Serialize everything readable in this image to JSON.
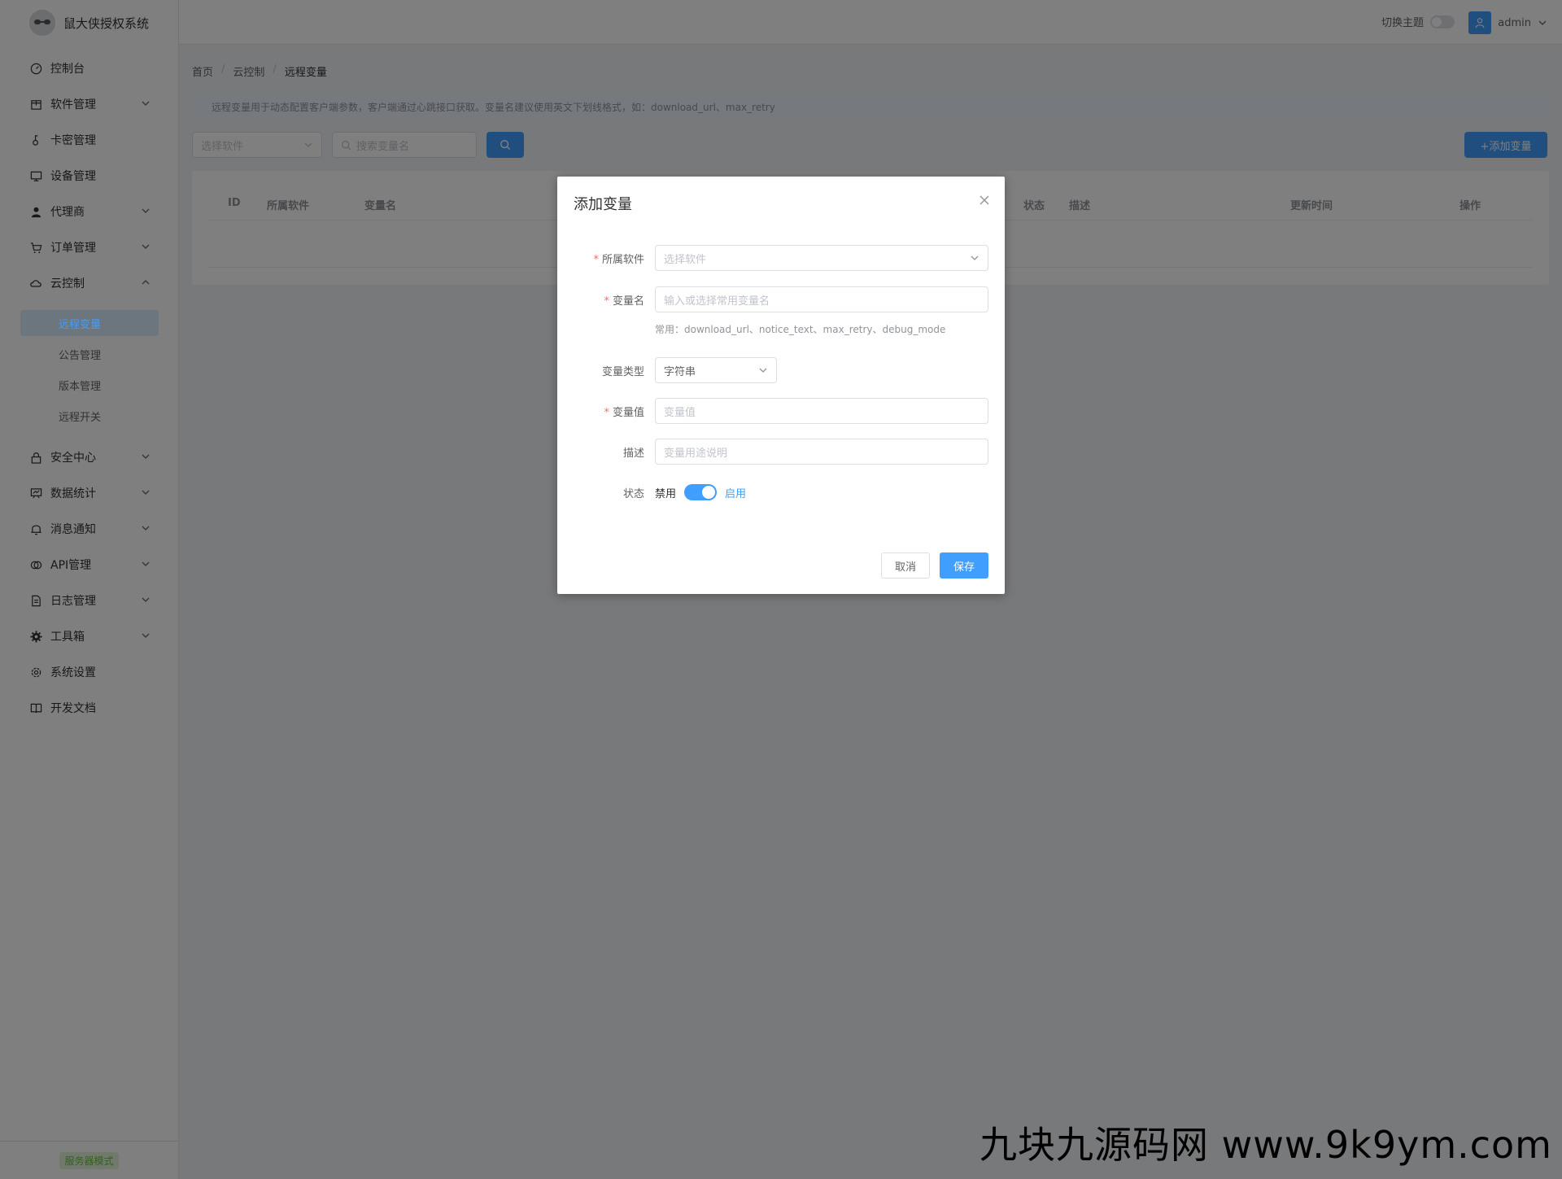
{
  "app": {
    "title": "鼠大侠授权系统"
  },
  "sidebar": {
    "items": [
      {
        "label": "控制台",
        "icon": "dashboard-icon"
      },
      {
        "label": "软件管理",
        "icon": "package-icon",
        "arrow": "down"
      },
      {
        "label": "卡密管理",
        "icon": "key-icon"
      },
      {
        "label": "设备管理",
        "icon": "monitor-icon"
      },
      {
        "label": "代理商",
        "icon": "user-icon",
        "arrow": "down"
      },
      {
        "label": "订单管理",
        "icon": "cart-icon",
        "arrow": "down"
      },
      {
        "label": "云控制",
        "icon": "cloud-icon",
        "arrow": "up"
      }
    ],
    "cloud_sub": [
      "远程变量",
      "公告管理",
      "版本管理",
      "远程开关"
    ],
    "items_after": [
      {
        "label": "安全中心",
        "icon": "lock-icon",
        "arrow": "down"
      },
      {
        "label": "数据统计",
        "icon": "chart-icon",
        "arrow": "down"
      },
      {
        "label": "消息通知",
        "icon": "bell-icon",
        "arrow": "down"
      },
      {
        "label": "API管理",
        "icon": "api-icon",
        "arrow": "down"
      },
      {
        "label": "日志管理",
        "icon": "document-icon",
        "arrow": "down"
      },
      {
        "label": "工具箱",
        "icon": "gear-icon",
        "arrow": "down"
      },
      {
        "label": "系统设置",
        "icon": "settings-icon"
      },
      {
        "label": "开发文档",
        "icon": "book-icon"
      }
    ],
    "footer_tag": "服务器模式"
  },
  "header": {
    "theme_label": "切换主题",
    "user_name": "admin"
  },
  "breadcrumb": {
    "home": "首页",
    "parent": "云控制",
    "current": "远程变量"
  },
  "tip": "远程变量用于动态配置客户端参数，客户端通过心跳接口获取。变量名建议使用英文下划线格式，如：download_url、max_retry",
  "filters": {
    "software_placeholder": "选择软件",
    "search_placeholder": "搜索变量名",
    "add_label": "+添加变量"
  },
  "table": {
    "columns": [
      "ID",
      "所属软件",
      "变量名",
      "状态",
      "描述",
      "更新时间",
      "操作"
    ]
  },
  "dialog": {
    "title": "添加变量",
    "software_label": "所属软件",
    "software_placeholder": "选择软件",
    "name_label": "变量名",
    "name_placeholder": "输入或选择常用变量名",
    "name_hint": "常用：download_url、notice_text、max_retry、debug_mode",
    "type_label": "变量类型",
    "type_value": "字符串",
    "value_label": "变量值",
    "value_placeholder": "变量值",
    "desc_label": "描述",
    "desc_placeholder": "变量用途说明",
    "status_label": "状态",
    "status_off": "禁用",
    "status_on": "启用",
    "status_enabled": true,
    "cancel": "取消",
    "save": "保存"
  },
  "watermark": "九块九源码网 www.9k9ym.com",
  "colors": {
    "primary": "#409eff",
    "danger": "#f56c6c",
    "success": "#67c23a"
  }
}
